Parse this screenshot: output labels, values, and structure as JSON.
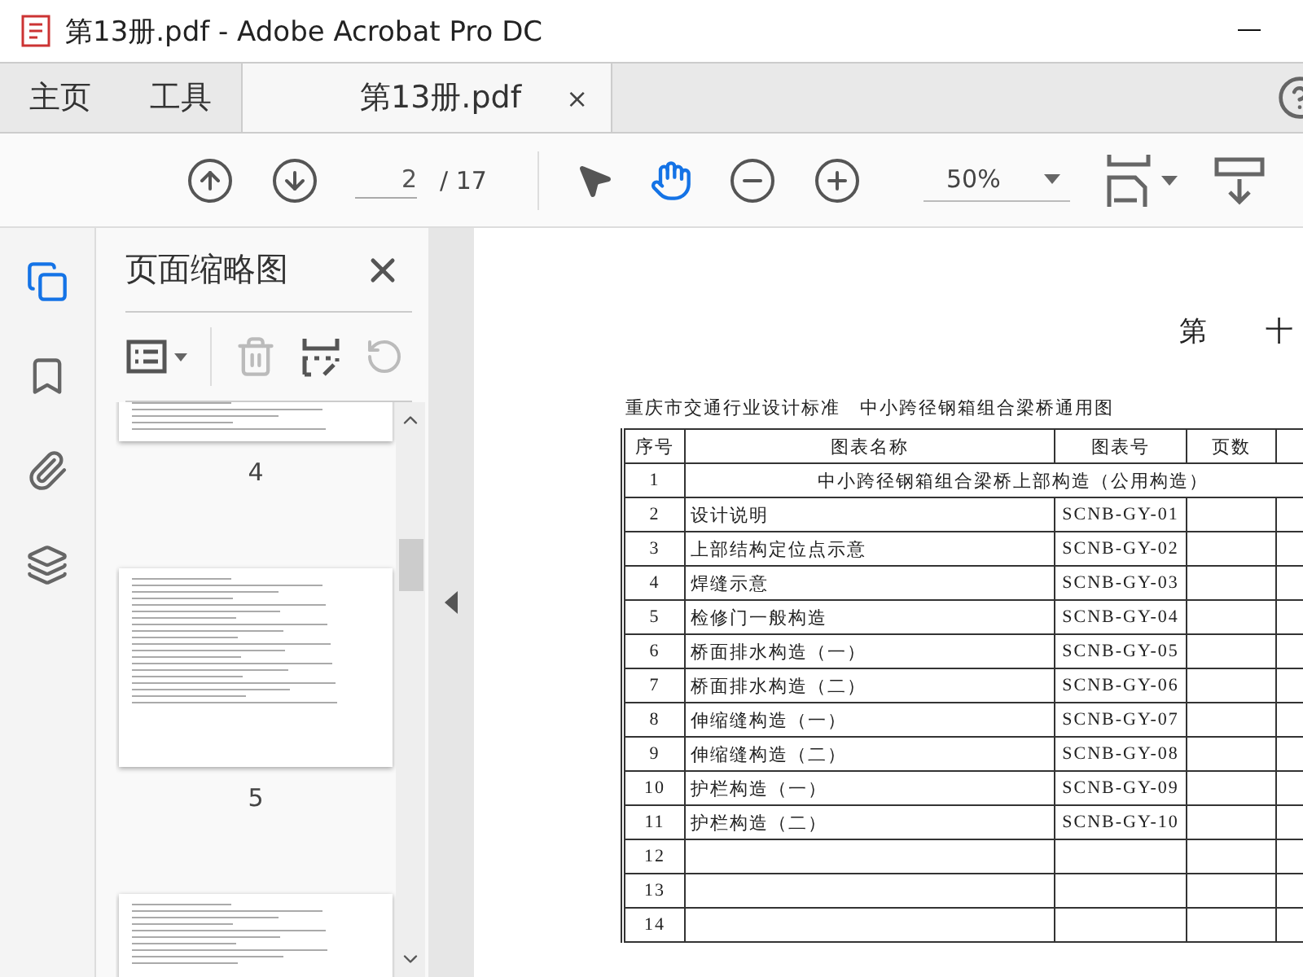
{
  "window": {
    "title": "第13册.pdf - Adobe Acrobat Pro DC"
  },
  "tabs": [
    {
      "label": "主页",
      "selected": false
    },
    {
      "label": "工具",
      "selected": false
    },
    {
      "label": "第13册.pdf",
      "selected": true,
      "close": "×"
    }
  ],
  "toolbar": {
    "page_input": "2",
    "page_total": "/ 17",
    "tools": [
      {
        "kind": "select",
        "selected": false
      },
      {
        "kind": "hand",
        "selected": true
      }
    ],
    "zoom": "50%"
  },
  "rail": [
    {
      "kind": "pages",
      "selected": true
    },
    {
      "kind": "bookmarks",
      "selected": false
    },
    {
      "kind": "attachments",
      "selected": false
    },
    {
      "kind": "layers",
      "selected": false
    }
  ],
  "panel": {
    "title": "页面缩略图",
    "actions": [
      {
        "kind": "delete",
        "disabled": true
      },
      {
        "kind": "extract",
        "disabled": false
      },
      {
        "kind": "undo",
        "disabled": true
      }
    ],
    "thumbnails": [
      {
        "kind": "cut_top",
        "label": "4"
      },
      {
        "kind": "full",
        "label": "5"
      },
      {
        "kind": "cut_bottom"
      }
    ]
  },
  "document": {
    "heading": [
      "第",
      "十"
    ],
    "subtitle": "重庆市交通行业设计标准　中小跨径钢箱组合梁桥通用图",
    "table": {
      "columns": [
        "序号",
        "图表名称",
        "图表号",
        "页数"
      ],
      "rows": [
        {
          "no": "1",
          "name": "中小跨径钢箱组合梁桥上部构造（公用构造）",
          "kind": "section"
        },
        {
          "no": "2",
          "name": "设计说明",
          "code": "SCNB-GY-01"
        },
        {
          "no": "3",
          "name": "上部结构定位点示意",
          "code": "SCNB-GY-02"
        },
        {
          "no": "4",
          "name": "焊缝示意",
          "code": "SCNB-GY-03"
        },
        {
          "no": "5",
          "name": "检修门一般构造",
          "code": "SCNB-GY-04"
        },
        {
          "no": "6",
          "name": "桥面排水构造（一）",
          "code": "SCNB-GY-05"
        },
        {
          "no": "7",
          "name": "桥面排水构造（二）",
          "code": "SCNB-GY-06"
        },
        {
          "no": "8",
          "name": "伸缩缝构造（一）",
          "code": "SCNB-GY-07"
        },
        {
          "no": "9",
          "name": "伸缩缝构造（二）",
          "code": "SCNB-GY-08"
        },
        {
          "no": "10",
          "name": "护栏构造（一）",
          "code": "SCNB-GY-09"
        },
        {
          "no": "11",
          "name": "护栏构造（二）",
          "code": "SCNB-GY-10"
        },
        {
          "no": "12"
        },
        {
          "no": "13"
        },
        {
          "no": "14"
        }
      ]
    }
  }
}
